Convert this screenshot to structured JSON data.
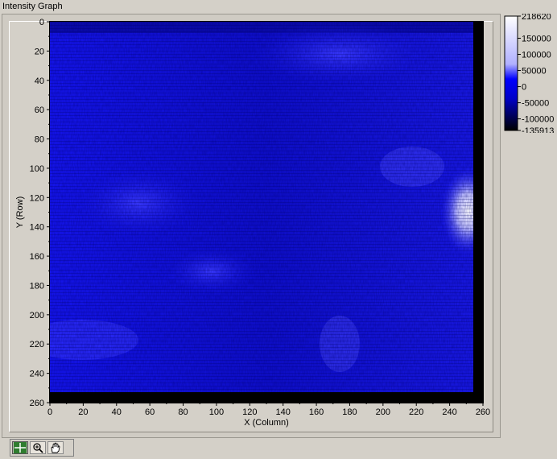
{
  "window": {
    "title": "Intensity Graph"
  },
  "graph": {
    "x_axis_label": "X (Column)",
    "y_axis_label": "Y (Row)",
    "x_ticks": [
      "0",
      "20",
      "40",
      "60",
      "80",
      "100",
      "120",
      "140",
      "160",
      "180",
      "200",
      "220",
      "240",
      "260"
    ],
    "y_ticks": [
      "0",
      "20",
      "40",
      "60",
      "80",
      "100",
      "120",
      "140",
      "160",
      "180",
      "200",
      "220",
      "240",
      "260"
    ]
  },
  "color_scale": {
    "ticks": [
      "218620",
      "150000",
      "100000",
      "50000",
      "0",
      "-50000",
      "-100000",
      "-135913"
    ],
    "colors": {
      "high": "#ffffff",
      "mid": "#0000ff",
      "low": "#000000"
    }
  },
  "toolbar": {
    "tools": [
      {
        "name": "cursor-tool",
        "icon": "crosshair-icon",
        "active": true
      },
      {
        "name": "zoom-tool",
        "icon": "zoom-icon",
        "active": false
      },
      {
        "name": "pan-tool",
        "icon": "hand-icon",
        "active": false
      }
    ]
  }
}
